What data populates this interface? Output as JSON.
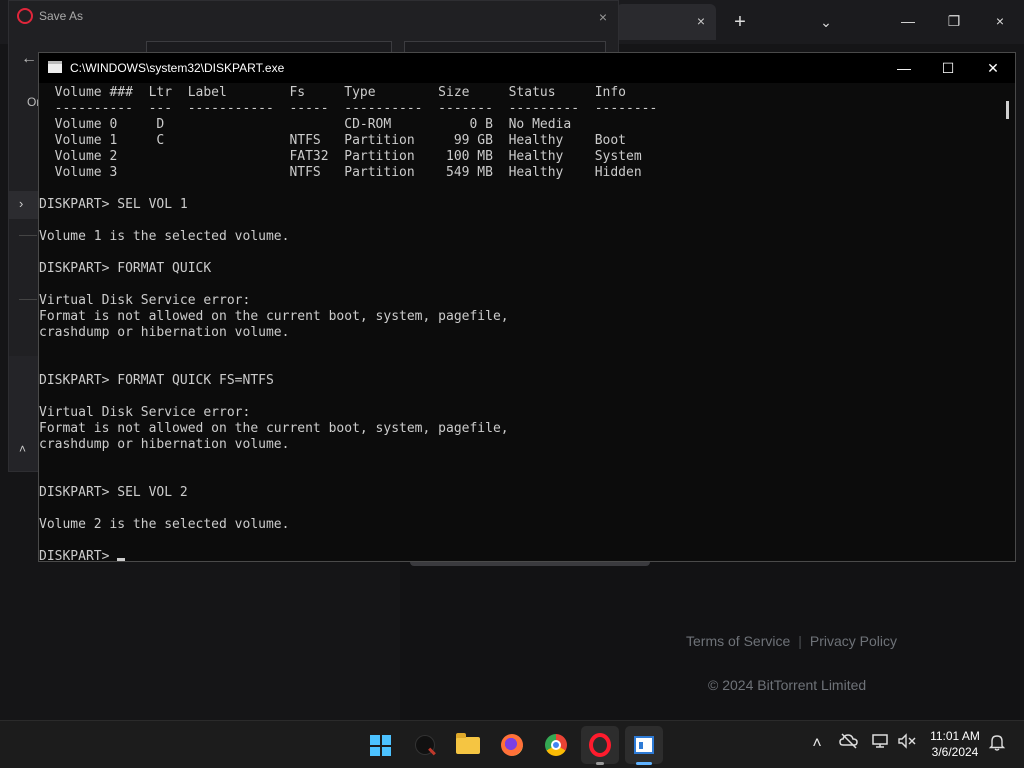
{
  "browser": {
    "tab_close": "×",
    "new_tab": "+",
    "tab_search": "⌄",
    "minimize": "—",
    "maximize": "❐",
    "close": "×",
    "footer": {
      "terms": "Terms of Service",
      "separator": "|",
      "privacy": "Privacy Policy",
      "copyright": "© 2024 BitTorrent Limited"
    }
  },
  "save_dialog": {
    "title": "Save As",
    "close": "×",
    "back": "←",
    "organize_partial": "Or",
    "nav_chevron": "›",
    "scroll_up": "˄"
  },
  "console": {
    "title": "C:\\WINDOWS\\system32\\DISKPART.exe",
    "minimize": "—",
    "maximize": "☐",
    "close": "✕",
    "lines": [
      "  Volume ###  Ltr  Label        Fs     Type        Size     Status     Info",
      "  ----------  ---  -----------  -----  ----------  -------  ---------  --------",
      "  Volume 0     D                       CD-ROM          0 B  No Media",
      "  Volume 1     C                NTFS   Partition     99 GB  Healthy    Boot",
      "  Volume 2                      FAT32  Partition    100 MB  Healthy    System",
      "  Volume 3                      NTFS   Partition    549 MB  Healthy    Hidden",
      "",
      "DISKPART> SEL VOL 1",
      "",
      "Volume 1 is the selected volume.",
      "",
      "DISKPART> FORMAT QUICK",
      "",
      "Virtual Disk Service error:",
      "Format is not allowed on the current boot, system, pagefile,",
      "crashdump or hibernation volume.",
      "",
      "",
      "DISKPART> FORMAT QUICK FS=NTFS",
      "",
      "Virtual Disk Service error:",
      "Format is not allowed on the current boot, system, pagefile,",
      "crashdump or hibernation volume.",
      "",
      "",
      "DISKPART> SEL VOL 2",
      "",
      "Volume 2 is the selected volume.",
      "",
      "DISKPART> "
    ]
  },
  "taskbar": {
    "icons": [
      "windows-start-icon",
      "search-icon",
      "file-explorer-icon",
      "firefox-icon",
      "chrome-icon",
      "opera-icon",
      "command-prompt-icon"
    ],
    "tray": {
      "chevron": "˄",
      "time": "11:01 AM",
      "date": "3/6/2024"
    }
  }
}
